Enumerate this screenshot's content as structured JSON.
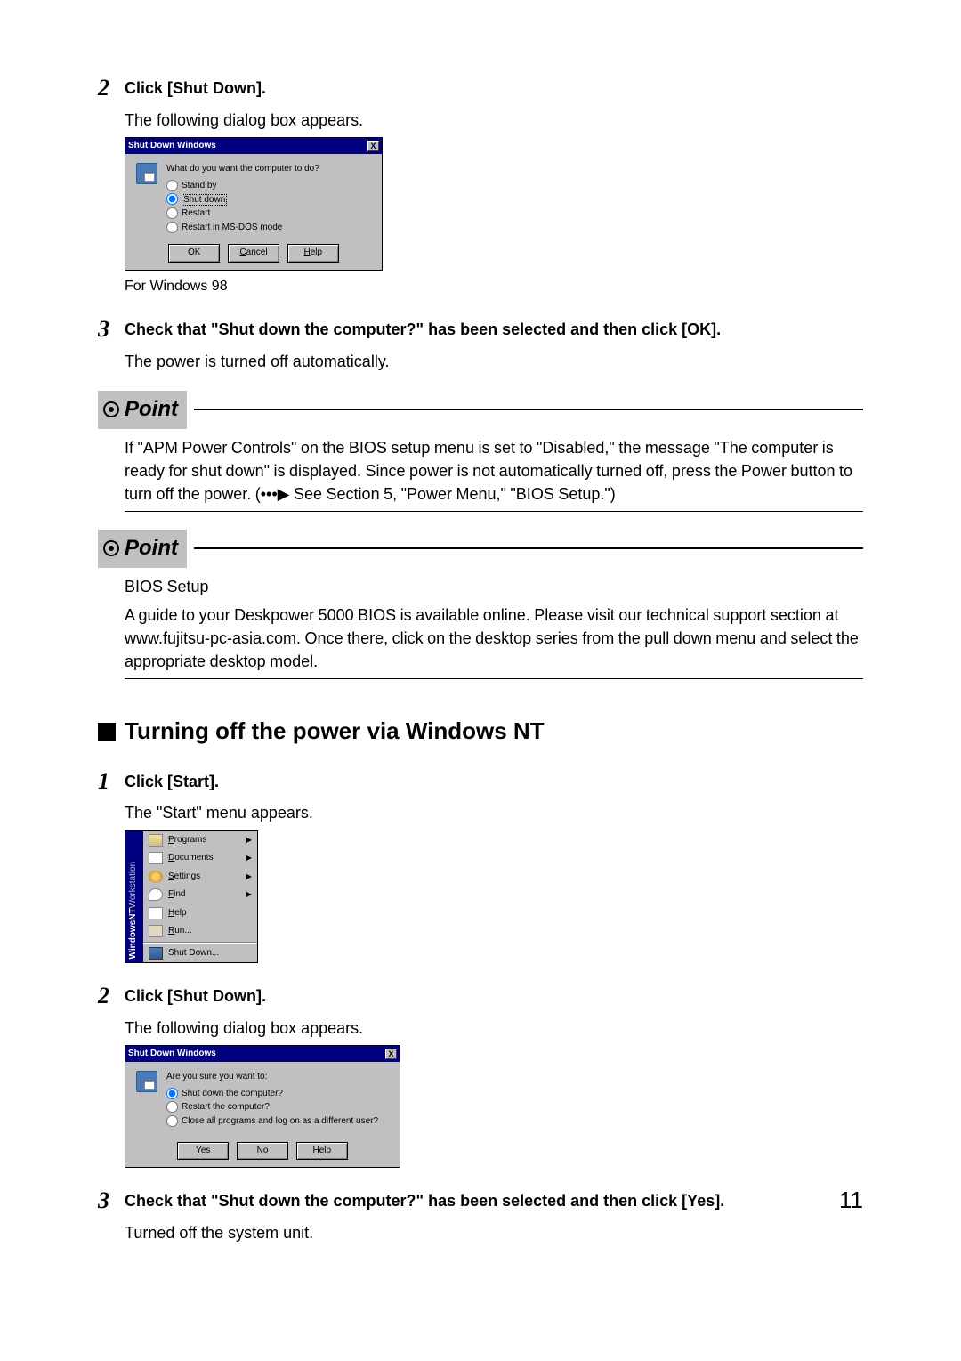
{
  "page_number": "11",
  "step2a": {
    "num": "2",
    "title": "Click [Shut Down].",
    "body": "The following dialog box appears.",
    "caption": "For Windows 98"
  },
  "dialog98": {
    "title": "Shut Down Windows",
    "close": "X",
    "question": "What do you want the computer to do?",
    "opt_standby": "Stand by",
    "opt_shutdown": "Shut down",
    "opt_restart": "Restart",
    "opt_msdos": "Restart in MS-DOS mode",
    "btn_ok": "OK",
    "btn_cancel": "Cancel",
    "btn_help": "Help"
  },
  "step3a": {
    "num": "3",
    "title": "Check that \"Shut down the computer?\" has been selected and then click [OK].",
    "body": "The power is turned off automatically."
  },
  "point1": {
    "label": "Point",
    "body": "If \"APM Power Controls\" on the BIOS setup menu is set to \"Disabled,\" the message \"The computer is ready for shut down\" is displayed.  Since power is not automatically turned off, press the Power button to turn off the power. (•••▶ See Section 5, \"Power Menu,\" \"BIOS Setup.\")"
  },
  "point2": {
    "label": "Point",
    "heading": "BIOS Setup",
    "body": "A guide to your Deskpower 5000 BIOS is available online. Please visit our technical support section at www.fujitsu-pc-asia.com. Once there, click on the desktop series from the pull down menu and select the appropriate desktop model."
  },
  "section": {
    "title": "Turning off the power via Windows NT"
  },
  "step1b": {
    "num": "1",
    "title": "Click [Start].",
    "body": "The \"Start\" menu appears."
  },
  "startmenu": {
    "brand_bold": "WindowsNT",
    "brand_light": "Workstation",
    "programs": "Programs",
    "documents": "Documents",
    "settings": "Settings",
    "find": "Find",
    "help": "Help",
    "run": "Run...",
    "shutdown": "Shut Down..."
  },
  "step2b": {
    "num": "2",
    "title": "Click [Shut Down].",
    "body": "The following dialog box appears."
  },
  "dialogNT": {
    "title": "Shut Down Windows",
    "close": "X",
    "question": "Are you sure you want to:",
    "opt_shutdown": "Shut down the computer?",
    "opt_restart": "Restart the computer?",
    "opt_close": "Close all programs and log on as a different user?",
    "btn_yes": "Yes",
    "btn_no": "No",
    "btn_help": "Help"
  },
  "step3b": {
    "num": "3",
    "title": "Check that \"Shut down the computer?\" has been selected and then click [Yes].",
    "body": "Turned off  the system unit."
  }
}
